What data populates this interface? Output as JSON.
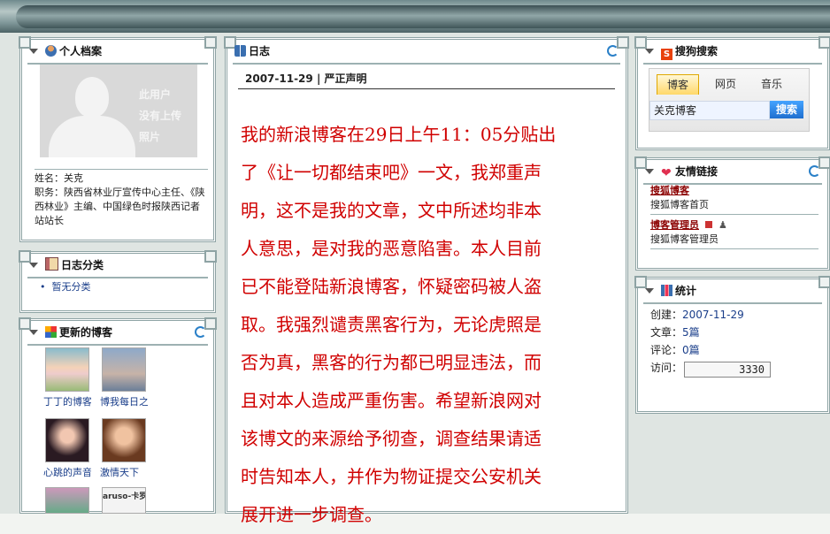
{
  "profile": {
    "title": "个人档案",
    "avatar_text": [
      "此用户",
      "没有上传",
      "照片"
    ],
    "name_label": "姓名：",
    "name": "关克",
    "job_label": "职务：",
    "job": "陕西省林业厅宣传中心主任、《陕西林业》主编、中国绿色时报陕西记者站站长"
  },
  "category": {
    "title": "日志分类",
    "items": [
      "暂无分类"
    ]
  },
  "updated": {
    "title": "更新的博客",
    "items": [
      {
        "label": "丁丁的博客"
      },
      {
        "label": "博我每日之"
      },
      {
        "label": "心跳的声音"
      },
      {
        "label": "激情天下"
      },
      {
        "label": ""
      },
      {
        "label": "aruso-卡罗"
      }
    ]
  },
  "blog": {
    "title": "日志",
    "entry_date": "2007-11-29",
    "separator": "|",
    "entry_title": "严正声明",
    "body_lines": [
      "我的新浪博客在29日上午11：05分贴出",
      "了《让一切都结束吧》一文，我郑重声",
      "明，这不是我的文章，文中所述均非本",
      "人意思，是对我的恶意陷害。本人目前",
      "已不能登陆新浪博客，怀疑密码被人盗",
      "取。我强烈谴责黑客行为，无论虎照是",
      "否为真，黑客的行为都已明显违法，而",
      "且对本人造成严重伤害。希望新浪网对",
      "该博文的来源给予彻查，调查结果请适",
      "时告知本人，并作为物证提交公安机关",
      "展开进一步调查。"
    ]
  },
  "search": {
    "title": "搜狗搜索",
    "tabs": [
      "博客",
      "网页",
      "音乐"
    ],
    "input_value": "关克博客",
    "button_label": "搜索"
  },
  "links": {
    "title": "友情链接",
    "items": [
      {
        "name": "搜狐博客",
        "desc": "搜狐博客首页"
      },
      {
        "name": "博客管理员",
        "desc": "搜狐博客管理员"
      }
    ]
  },
  "stats": {
    "title": "统计",
    "created_label": "创建：",
    "created": "2007-11-29",
    "articles_label": "文章：",
    "articles": "5篇",
    "comments_label": "评论：",
    "comments": "0篇",
    "visits_label": "访问：",
    "visits": "3330"
  },
  "colors": {
    "body_text": "#d00000",
    "link": "#8b0000",
    "accent_blue": "#1f6fcf"
  }
}
